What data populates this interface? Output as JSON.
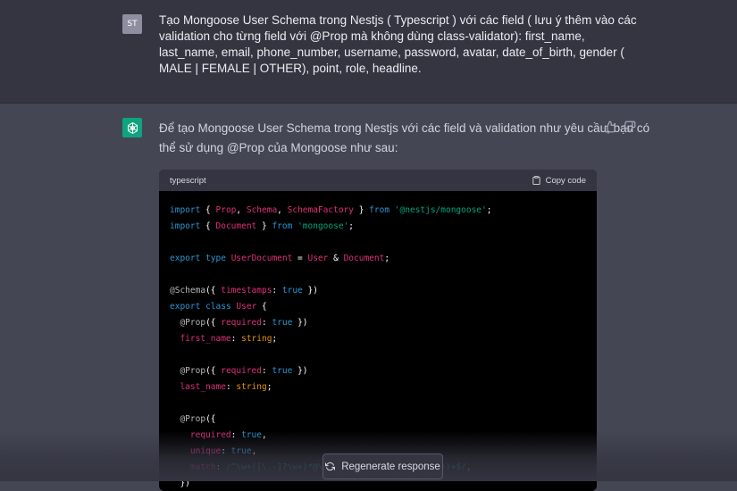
{
  "user_message": {
    "avatar_initials": "ST",
    "lines": [
      "Tạo Mongoose User Schema trong Nestjs ( Typescript ) với các field ( lưu ý thêm vào các",
      "validation cho từng field với @Prop mà không dùng class-validator): first_name,",
      "last_name, email, phone_number, username, password, avatar, date_of_birth, gender (",
      "MALE | FEMALE | OTHER), point, role, headline."
    ]
  },
  "assistant_message": {
    "avatar_icon": "openai-logo-icon",
    "lines": [
      "Để tạo Mongoose User Schema trong Nestjs với các field và validation như yêu cầu, bạn có",
      "thể sử dụng @Prop của Mongoose như sau:"
    ],
    "feedback_icons": [
      "thumbs-up-icon",
      "thumbs-down-icon"
    ]
  },
  "code_block": {
    "language": "typescript",
    "copy_label": "Copy code",
    "lines": [
      [
        [
          "kw",
          "import"
        ],
        [
          "txt",
          " { "
        ],
        [
          "id",
          "Prop"
        ],
        [
          "txt",
          ", "
        ],
        [
          "id",
          "Schema"
        ],
        [
          "txt",
          ", "
        ],
        [
          "id",
          "SchemaFactory"
        ],
        [
          "txt",
          " } "
        ],
        [
          "kw",
          "from"
        ],
        [
          "txt",
          " "
        ],
        [
          "str",
          "'@nestjs/mongoose'"
        ],
        [
          "txt",
          ";"
        ]
      ],
      [
        [
          "kw",
          "import"
        ],
        [
          "txt",
          " { "
        ],
        [
          "id",
          "Document"
        ],
        [
          "txt",
          " } "
        ],
        [
          "kw",
          "from"
        ],
        [
          "txt",
          " "
        ],
        [
          "str",
          "'mongoose'"
        ],
        [
          "txt",
          ";"
        ]
      ],
      [],
      [
        [
          "kw",
          "export"
        ],
        [
          "txt",
          " "
        ],
        [
          "kw",
          "type"
        ],
        [
          "txt",
          " "
        ],
        [
          "id",
          "UserDocument"
        ],
        [
          "txt",
          " = "
        ],
        [
          "id",
          "User"
        ],
        [
          "txt",
          " & "
        ],
        [
          "id",
          "Document"
        ],
        [
          "txt",
          ";"
        ]
      ],
      [],
      [
        [
          "dec",
          "@Schema"
        ],
        [
          "txt",
          "({ "
        ],
        [
          "prop",
          "timestamps"
        ],
        [
          "txt",
          ": "
        ],
        [
          "kw",
          "true"
        ],
        [
          "txt",
          " })"
        ]
      ],
      [
        [
          "kw",
          "export"
        ],
        [
          "txt",
          " "
        ],
        [
          "kw",
          "class"
        ],
        [
          "txt",
          " "
        ],
        [
          "id",
          "User"
        ],
        [
          "txt",
          " {"
        ]
      ],
      [
        [
          "txt",
          "  "
        ],
        [
          "dec",
          "@Prop"
        ],
        [
          "txt",
          "({ "
        ],
        [
          "prop",
          "required"
        ],
        [
          "txt",
          ": "
        ],
        [
          "kw",
          "true"
        ],
        [
          "txt",
          " })"
        ]
      ],
      [
        [
          "txt",
          "  "
        ],
        [
          "prop",
          "first_name"
        ],
        [
          "txt",
          ": "
        ],
        [
          "type",
          "string"
        ],
        [
          "txt",
          ";"
        ]
      ],
      [],
      [
        [
          "txt",
          "  "
        ],
        [
          "dec",
          "@Prop"
        ],
        [
          "txt",
          "({ "
        ],
        [
          "prop",
          "required"
        ],
        [
          "txt",
          ": "
        ],
        [
          "kw",
          "true"
        ],
        [
          "txt",
          " })"
        ]
      ],
      [
        [
          "txt",
          "  "
        ],
        [
          "prop",
          "last_name"
        ],
        [
          "txt",
          ": "
        ],
        [
          "type",
          "string"
        ],
        [
          "txt",
          ";"
        ]
      ],
      [],
      [
        [
          "txt",
          "  "
        ],
        [
          "dec",
          "@Prop"
        ],
        [
          "txt",
          "({"
        ]
      ],
      [
        [
          "txt",
          "    "
        ],
        [
          "prop",
          "required"
        ],
        [
          "txt",
          ": "
        ],
        [
          "kw",
          "true"
        ],
        [
          "txt",
          ","
        ]
      ],
      [
        [
          "txt",
          "    "
        ],
        [
          "prop",
          "unique"
        ],
        [
          "txt",
          ": "
        ],
        [
          "kw",
          "true"
        ],
        [
          "txt",
          ","
        ]
      ],
      [
        [
          "txt",
          "    "
        ],
        [
          "prop",
          "match"
        ],
        [
          "txt",
          ": "
        ],
        [
          "str",
          "/^\\w+([\\.-]?\\w+)*@\\w+([\\.-]?\\w+)*(\\.\\w{2,3})+$/"
        ],
        [
          "txt",
          ","
        ]
      ],
      [
        [
          "txt",
          "  })"
        ]
      ]
    ]
  },
  "regenerate": {
    "label": "Regenerate response",
    "icon": "refresh-icon"
  },
  "colors": {
    "page_bg": "#343541",
    "assistant_bg": "#444654",
    "code_bg": "#000000",
    "code_header_bg": "#343541",
    "user_avatar": "#8e8ea0",
    "bot_avatar": "#10a37f",
    "keyword": "#2e95d3",
    "identifier": "#df3079",
    "string": "#00a67d",
    "type": "#e9950c"
  }
}
